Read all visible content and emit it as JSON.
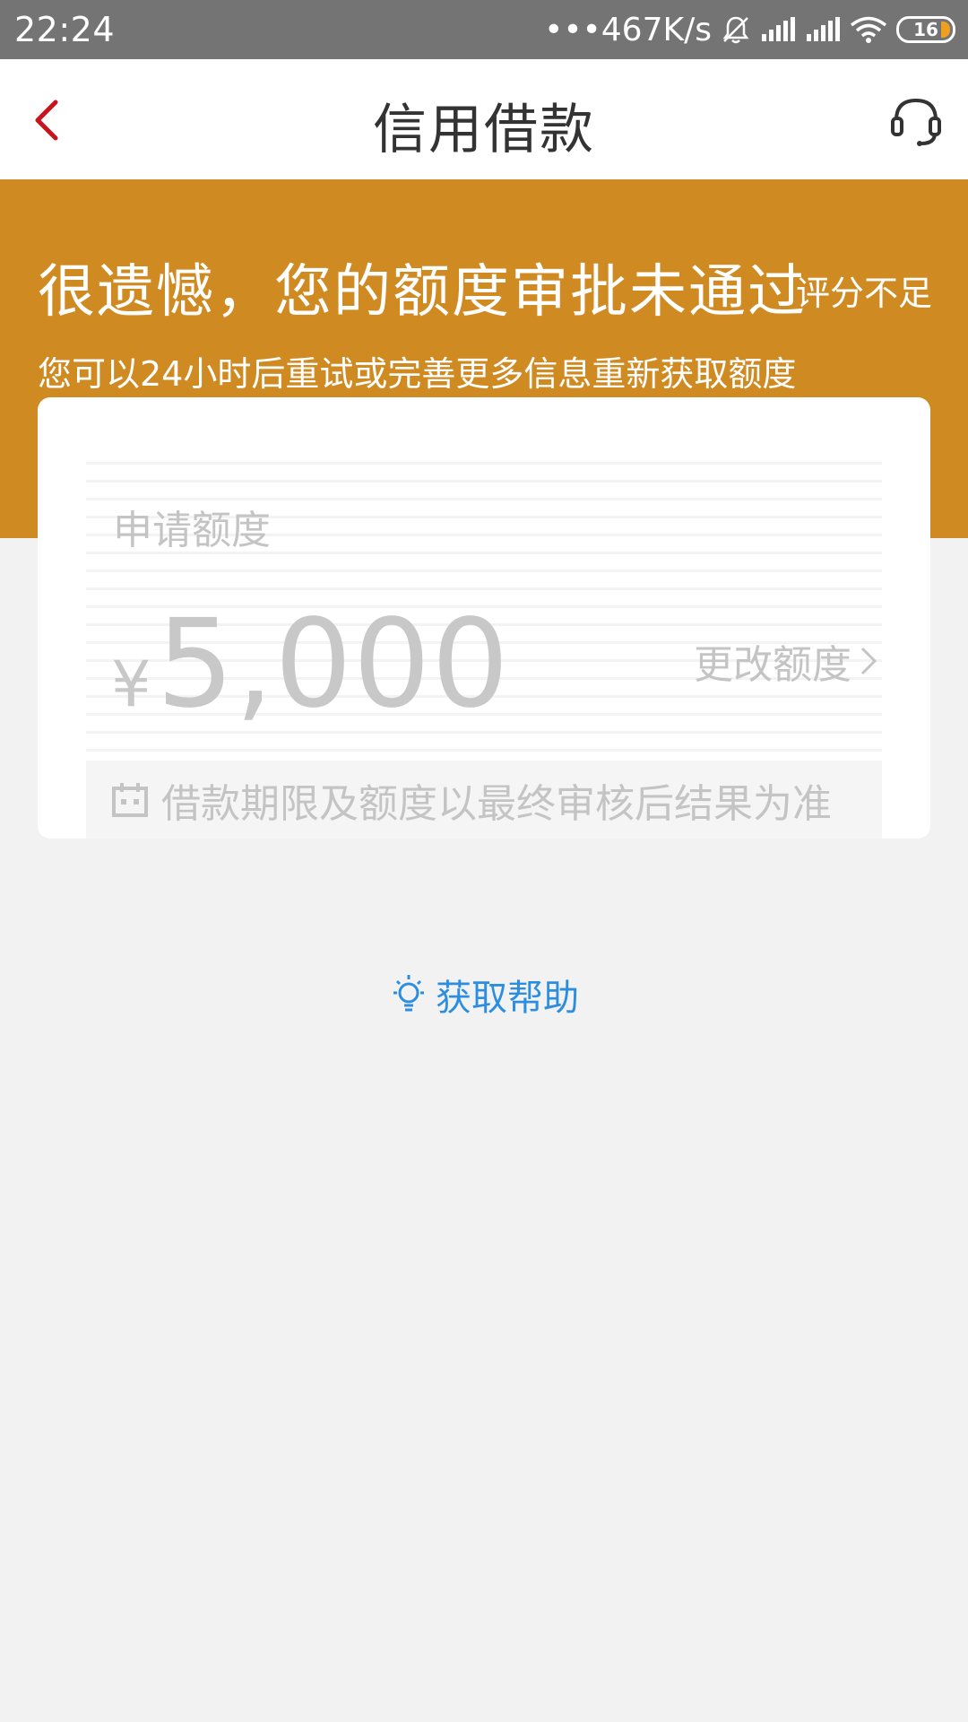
{
  "status_bar": {
    "time": "22:24",
    "net_speed": "•••467K/s",
    "battery_level": "16",
    "icons": [
      "bell-off-icon",
      "signal-icon",
      "signal-icon",
      "wifi-icon",
      "battery-icon"
    ]
  },
  "nav": {
    "title": "信用借款",
    "back_icon": "chevron-left-icon",
    "service_icon": "headset-icon"
  },
  "banner": {
    "title": "很遗憾，您的额度审批未通过",
    "reason": "评分不足",
    "subtitle": "您可以24小时后重试或完善更多信息重新获取额度"
  },
  "card": {
    "label": "申请额度",
    "currency": "¥",
    "amount": "5,000",
    "change_label": "更改额度",
    "notice": "借款期限及额度以最终审核后结果为准",
    "notice_icon": "calendar-icon"
  },
  "help": {
    "label": "获取帮助",
    "icon": "lightbulb-icon"
  },
  "colors": {
    "banner": "#d08a22",
    "back": "#c8141e",
    "link": "#2d8ee0",
    "status_bar": "#747474"
  }
}
